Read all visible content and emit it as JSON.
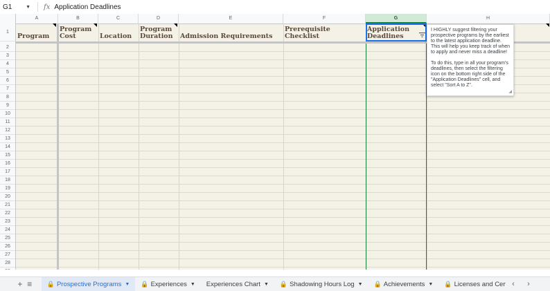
{
  "formula_bar": {
    "cell_ref": "G1",
    "fx": "fx",
    "content": "Application Deadlines"
  },
  "columns": [
    "A",
    "B",
    "C",
    "D",
    "E",
    "F",
    "G",
    "H"
  ],
  "rows": [
    "1",
    "2",
    "3",
    "4",
    "5",
    "6",
    "7",
    "8",
    "9",
    "10",
    "11",
    "12",
    "13",
    "14",
    "15",
    "16",
    "17",
    "18",
    "19",
    "20",
    "21",
    "22",
    "23",
    "24",
    "25",
    "26",
    "27",
    "28",
    "29"
  ],
  "headers": {
    "a": "Program",
    "b": "Program Cost",
    "c": "Location",
    "d": "Program Duration",
    "e": "Admission Requirements",
    "f": "Prerequisite Checklist",
    "g": "Application Deadlines"
  },
  "comment": {
    "para1": "I HIGHLY suggest filtering your prospective programs by the earliest to the latest application deadline. This will help you keep track of when to apply and never miss a deadline!",
    "para2": "To do this, type in all your program's deadlines, then select the filtering icon on the bottom right side of the \"Application Deadlines\" cell, and select \"Sort A to Z\"."
  },
  "sheet_tabs": [
    {
      "label": "Prospective Programs",
      "locked": true,
      "active": true
    },
    {
      "label": "Experiences",
      "locked": true,
      "active": false
    },
    {
      "label": "Experiences Chart",
      "locked": false,
      "active": false
    },
    {
      "label": "Shadowing Hours Log",
      "locked": true,
      "active": false
    },
    {
      "label": "Achievements",
      "locked": true,
      "active": false
    },
    {
      "label": "Licenses and Certifications",
      "locked": true,
      "active": false
    }
  ],
  "colors": {
    "accent": "#1a73e8",
    "selected_col": "#188038",
    "grid_bg": "#f4f1e7",
    "header_text": "#5a4a3c"
  }
}
